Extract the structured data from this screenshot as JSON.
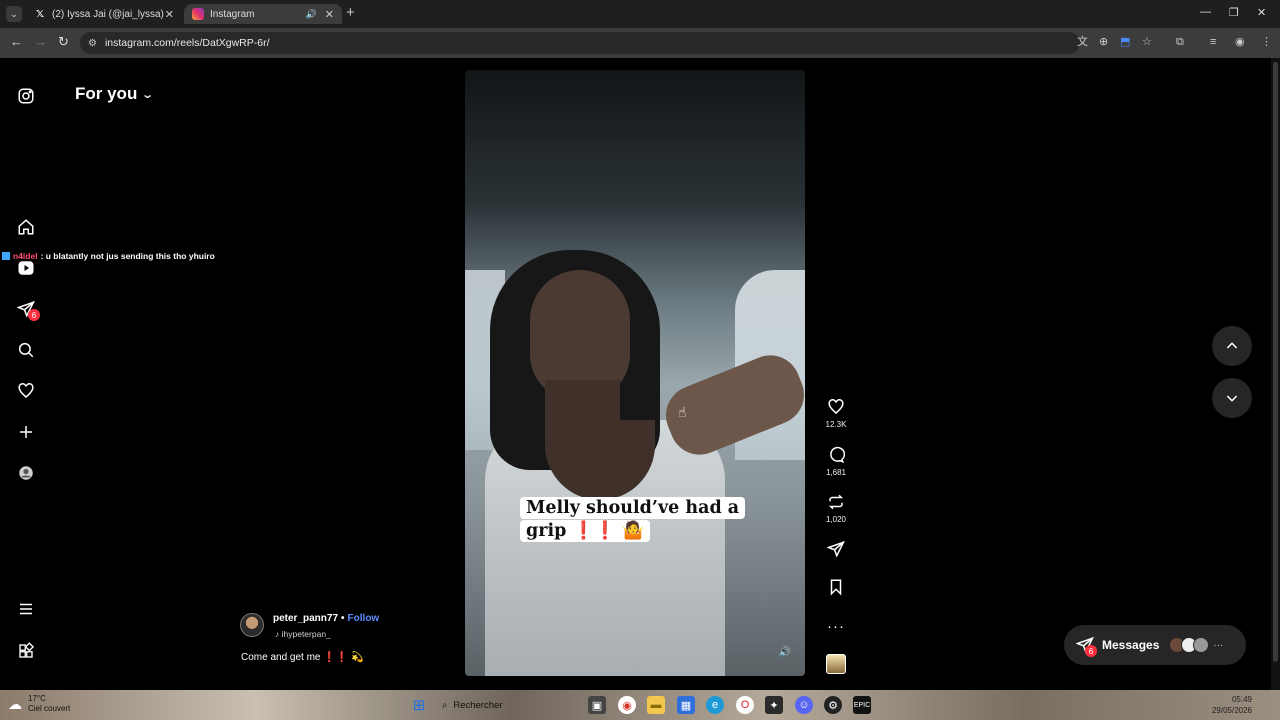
{
  "browser": {
    "tabs": [
      {
        "title": "(2) Iyssa Jai (@jai_lyssa) / X",
        "icon": "x-logo-icon"
      },
      {
        "title": "Instagram",
        "icon": "instagram-icon",
        "active": true
      }
    ],
    "url": "instagram.com/reels/DatXgwRP-6r/"
  },
  "nav": {
    "feed_title": "For you",
    "notifications_badge": "6"
  },
  "chat_overlay": {
    "user": "n4idel",
    "message": ": u blatantly not jus sending this tho yhuiro"
  },
  "video": {
    "caption_line1": "Melly should’ve had a",
    "caption_line2": "grip",
    "caption_emojis": "❗❗"
  },
  "actions": {
    "likes": "12.3K",
    "comments": "1,681",
    "reposts": "1,020"
  },
  "post": {
    "username": "peter_pann77",
    "follow_label": "Follow",
    "audio": "ihypeterpan_",
    "caption": "Come and get me",
    "caption_emojis": "❗❗"
  },
  "messages": {
    "label": "Messages",
    "badge": "6",
    "more": "···"
  },
  "taskbar": {
    "temperature": "17°C",
    "weather": "Ciel couvert",
    "search": "Rechercher",
    "time": "05:49",
    "date": "29/05/2026"
  },
  "colors": {
    "accent_follow": "#5c8cff",
    "badge_red": "#ff3040",
    "background": "#000000"
  }
}
